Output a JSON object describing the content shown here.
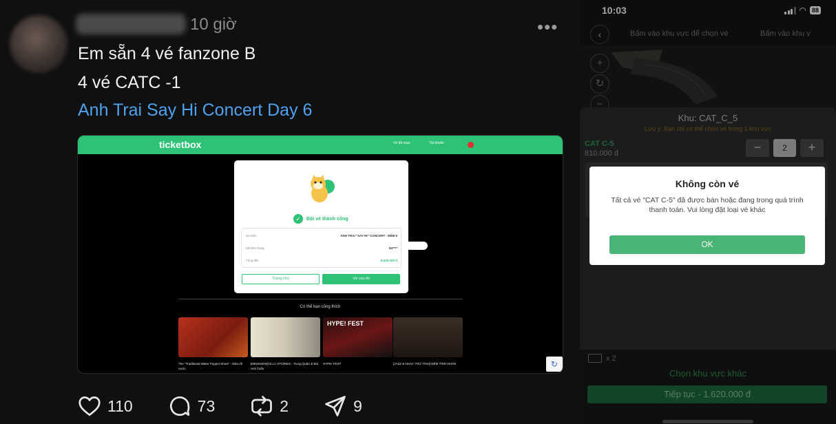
{
  "post": {
    "timestamp": "10 giờ",
    "more": "•••",
    "lines": [
      "Em sẵn 4 vé fanzone B",
      "4 vé CATC -1",
      "Anh Trai Say Hi Concert Day 6"
    ],
    "embed": {
      "logo": "ticketbox",
      "nav_tickets": "Vé đã mua",
      "nav_account": "Tài khoản",
      "success": "Đặt vé thành công",
      "rows": [
        {
          "label": "Sự kiện",
          "value": "ANH TRAI \"SAY HI\" CONCERT - ĐÊM 6"
        },
        {
          "label": "Mã đơn hàng",
          "value": "84****"
        },
        {
          "label": "Tổng tiền",
          "value": "8.000.000 đ"
        }
      ],
      "btn_home": "Trang chủ",
      "btn_tickets": "Vé của tôi",
      "rec_title": "Có thể bạn cũng thích",
      "rec_cards": [
        {
          "tag": "",
          "label": "The \"Traditional Water Puppet Show\" - Múa rối nước"
        },
        {
          "tag": "",
          "label": "[MINISHOW] B.U.I STORIES - Trung Quân & Bùi Anh Tuấn"
        },
        {
          "tag": "HYPE! FEST",
          "label": "HYPE! FEST"
        },
        {
          "tag": "",
          "label": "[JAZZ & NHẠC TRỮ TÌNH] ĐÊM TÌNH NHÂN"
        }
      ]
    },
    "likes": "110",
    "comments": "73",
    "reposts": "2",
    "shares": "9"
  },
  "phone": {
    "time": "10:03",
    "battery": "88",
    "nav_title_1": "Bấm vào khu vực để chọn vé",
    "nav_title_2": "Bấm vào khu v",
    "zone_title": "Khu: CAT_C_5",
    "zone_note": "Lưu ý: Bạn chỉ có thể chọn vé trong 1 khu vực",
    "ticket_name": "CAT C-5",
    "ticket_price": "810.000 đ",
    "quantity": "2",
    "ticket_count": "x 2",
    "alt_link": "Chọn khu vực khác",
    "continue_label": "Tiếp tục - 1.620.000 đ",
    "dialog": {
      "title": "Không còn vé",
      "message": "Tất cả vé \"CAT C-5\" đã được bán hoặc đang trong quá trình thanh toán. Vui lòng đặt loại vé khác",
      "ok": "OK"
    }
  },
  "colors": {
    "link": "#4da3ef",
    "ticketbox_green": "#2dc275",
    "ok_button": "#48b475",
    "continue_button": "#1d6b3d"
  }
}
